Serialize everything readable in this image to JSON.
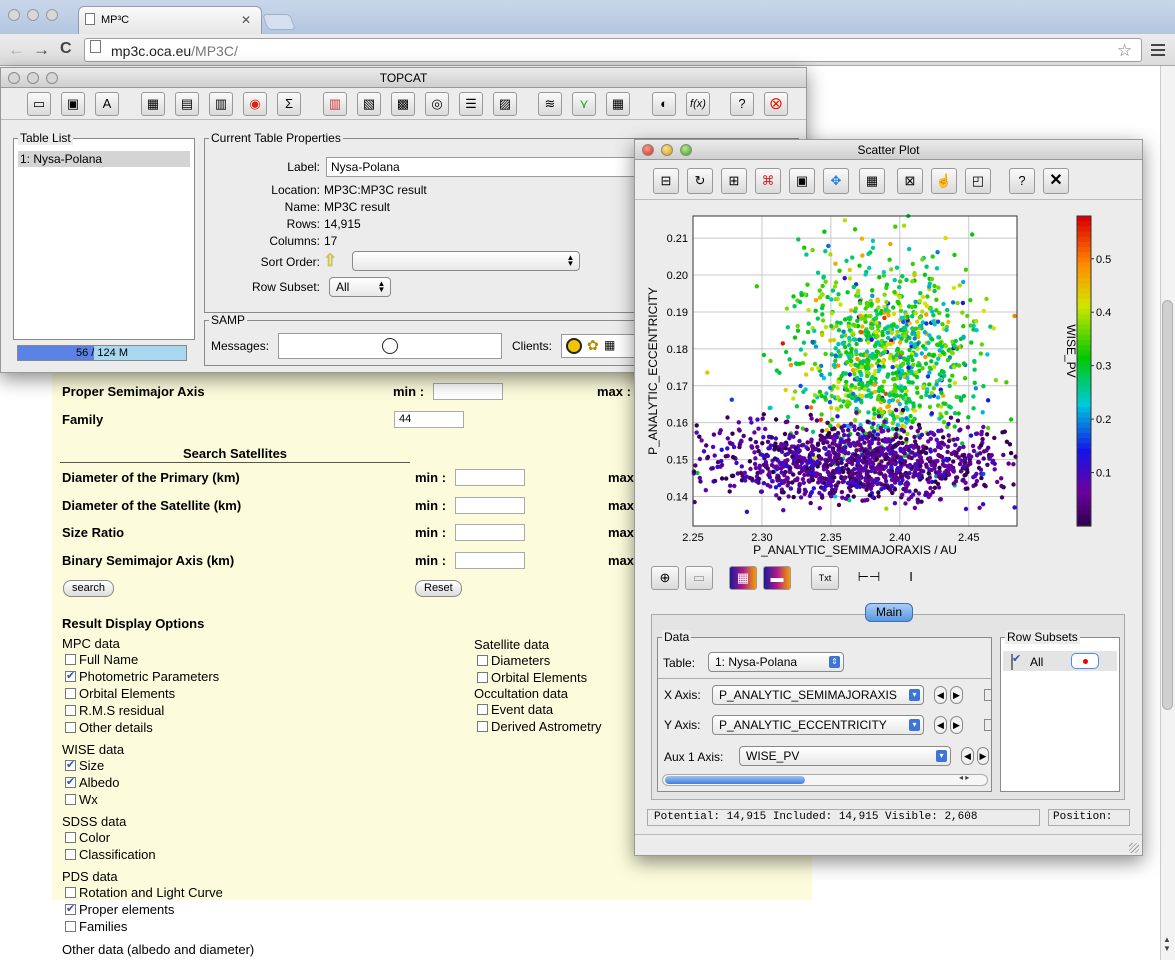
{
  "browser": {
    "tab_title": "MP³C",
    "tab_close": "✕",
    "url_domain": "mp3c.oca.eu",
    "url_path": "/MP3C/",
    "back": "←",
    "forward": "→",
    "reload": "C",
    "star": "☆"
  },
  "webpage": {
    "proper_semimajor_label": "Proper Semimajor Axis",
    "min_label": "min :",
    "max_label": "max :",
    "max_cut": "max",
    "family_label": "Family",
    "family_value": "44",
    "search_satellites_heading": "Search Satellites",
    "satellite_rows": [
      "Diameter of the Primary (km)",
      "Diameter of the Satellite (km)",
      "Size Ratio",
      "Binary Semimajor Axis (km)"
    ],
    "search_button": "search",
    "reset_button": "Reset",
    "result_display_heading": "Result Display Options",
    "mpc_heading": "MPC data",
    "mpc_items": [
      {
        "label": "Full Name",
        "checked": false
      },
      {
        "label": "Photometric Parameters",
        "checked": true
      },
      {
        "label": "Orbital Elements",
        "checked": false
      },
      {
        "label": "R.M.S residual",
        "checked": false
      },
      {
        "label": "Other details",
        "checked": false
      }
    ],
    "wise_heading": "WISE data",
    "wise_items": [
      {
        "label": "Size",
        "checked": true
      },
      {
        "label": "Albedo",
        "checked": true
      },
      {
        "label": "Wx",
        "checked": false
      }
    ],
    "sdss_heading": "SDSS data",
    "sdss_items": [
      {
        "label": "Color",
        "checked": false
      },
      {
        "label": "Classification",
        "checked": false
      }
    ],
    "pds_heading": "PDS data",
    "pds_items": [
      {
        "label": "Rotation and Light Curve",
        "checked": false
      },
      {
        "label": "Proper elements",
        "checked": true
      },
      {
        "label": "Families",
        "checked": false
      }
    ],
    "other_heading": "Other data (albedo and diameter)",
    "satellite_data_heading": "Satellite data",
    "satellite_items": [
      {
        "label": "Diameters",
        "checked": false
      },
      {
        "label": "Orbital Elements",
        "checked": false
      }
    ],
    "occultation_heading": "Occultation data",
    "occultation_items": [
      {
        "label": "Event data",
        "checked": false
      },
      {
        "label": "Derived Astrometry",
        "checked": false
      }
    ]
  },
  "topcat": {
    "title": "TOPCAT",
    "table_list_label": "Table List",
    "table_list_items": [
      "1: Nysa-Polana"
    ],
    "memory_text": "56 / 124 M",
    "memory_used_fraction": 0.45,
    "current_props_label": "Current Table Properties",
    "label_label": "Label:",
    "label_value": "Nysa-Polana",
    "props": [
      {
        "k": "Location:",
        "v": "MP3C:MP3C result"
      },
      {
        "k": "Name:",
        "v": "MP3C result"
      },
      {
        "k": "Rows:",
        "v": "14,915"
      },
      {
        "k": "Columns:",
        "v": "17"
      }
    ],
    "sort_order_label": "Sort Order:",
    "row_subset_label": "Row Subset:",
    "row_subset_value": "All",
    "samp_label": "SAMP",
    "messages_label": "Messages:",
    "clients_label": "Clients:",
    "toolbar_icons": [
      "open-icon",
      "save-icon",
      "broadcast-icon",
      "table-icon",
      "columns-icon",
      "parameters-icon",
      "subsets-icon",
      "statistics-icon",
      "histogram-icon",
      "plot2d-icon",
      "plot3d-icon",
      "sphere-icon",
      "stack-icon",
      "density-icon",
      "concat-icon",
      "match-icon",
      "multimatch-icon",
      "samp-icon",
      "function-icon",
      "help-icon",
      "exit-icon"
    ],
    "toolbar_glyphs": [
      "▭",
      "▣",
      "A",
      "▦",
      "▤",
      "▥",
      "◉",
      "Σ",
      "▥",
      "▧",
      "▩",
      "◎",
      "☰",
      "▨",
      "≋",
      "⋎",
      "▦",
      "◐",
      "f(x)",
      "?",
      "⊗"
    ]
  },
  "scatter": {
    "title": "Scatter Plot",
    "toolbar_glyphs": [
      "⊟",
      "↻",
      "⊞",
      "⌘",
      "▣",
      "✥",
      "▦",
      "⊠",
      "☝",
      "◰",
      "?",
      "✕"
    ],
    "toolbar_icons": [
      "axis-swap-icon",
      "replot-icon",
      "resize-icon",
      "pdf-icon",
      "export-icon",
      "navigate-icon",
      "grid-icon",
      "legend-icon",
      "subset-draw-icon",
      "subset-blob-icon",
      "help-icon",
      "close-icon"
    ],
    "tool2_glyphs": [
      "⊕",
      "▭",
      "▦",
      "▬",
      "Txt",
      "⊢⊣",
      "I"
    ],
    "tool2_icons": [
      "add-dataset-icon",
      "remove-dataset-icon",
      "add-aux-icon",
      "remove-aux-icon",
      "text-label-icon",
      "errorbar-x-icon",
      "errorbar-y-icon"
    ],
    "main_tab": "Main",
    "data_label": "Data",
    "table_label": "Table:",
    "table_value": "1: Nysa-Polana",
    "x_axis_label": "X Axis:",
    "x_axis_value": "P_ANALYTIC_SEMIMAJORAXIS",
    "y_axis_label": "Y Axis:",
    "y_axis_value": "P_ANALYTIC_ECCENTRICITY",
    "aux_axis_label": "Aux 1 Axis:",
    "aux_axis_value": "WISE_PV",
    "row_subsets_label": "Row Subsets",
    "subset_all": "All",
    "status_text": "Potential: 14,915 Included: 14,915 Visible:  2,608",
    "position_label": "Position:",
    "accent": "#4a8fe0"
  },
  "chart_data": {
    "type": "scatter",
    "xlabel": "P_ANALYTIC_SEMIMAJORAXIS / AU",
    "ylabel": "P_ANALYTIC_ECCENTRICITY",
    "colorbar_label": "WISE_PV",
    "xlim": [
      2.25,
      2.485
    ],
    "ylim": [
      0.132,
      0.216
    ],
    "xticks": [
      2.25,
      2.3,
      2.35,
      2.4,
      2.45
    ],
    "yticks": [
      0.14,
      0.15,
      0.16,
      0.17,
      0.18,
      0.19,
      0.2,
      0.21
    ],
    "clim": [
      0.0,
      0.58
    ],
    "cticks": [
      0.1,
      0.2,
      0.3,
      0.4,
      0.5
    ],
    "grid": true,
    "visible_points": 2608,
    "clusters": [
      {
        "name": "",
        "x_center": 2.39,
        "x_spread": 0.032,
        "y_center": 0.178,
        "y_spread": 0.013,
        "pv_center": 0.32,
        "pv_spread": 0.08,
        "count": 1050
      },
      {
        "name": "",
        "x_center": 2.37,
        "x_spread": 0.055,
        "y_center": 0.149,
        "y_spread": 0.005,
        "pv_center": 0.06,
        "pv_spread": 0.04,
        "count": 1250
      }
    ]
  }
}
